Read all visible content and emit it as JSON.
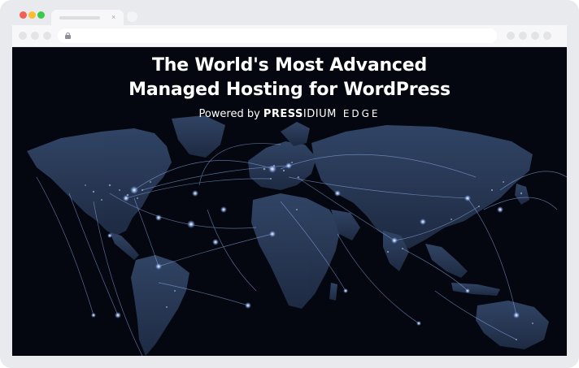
{
  "browser": {
    "tab_close_glyph": "×",
    "icons": [
      "close-dot",
      "minimize-dot",
      "maximize-dot",
      "lock-icon"
    ]
  },
  "hero": {
    "title_line1": "The World's Most Advanced",
    "title_line2": "Managed Hosting for WordPress",
    "powered_by": "Powered by",
    "brand_bold": "PRESS",
    "brand_light": "IDIUM",
    "brand_product": "EDGE"
  },
  "colors": {
    "window_frame": "#e9eaee",
    "close": "#f25f58",
    "minimize": "#fbbe2e",
    "maximize": "#3bc94a",
    "background": "#04070f",
    "land": "#2a3a57",
    "light_glow": "#a8c8ff"
  }
}
